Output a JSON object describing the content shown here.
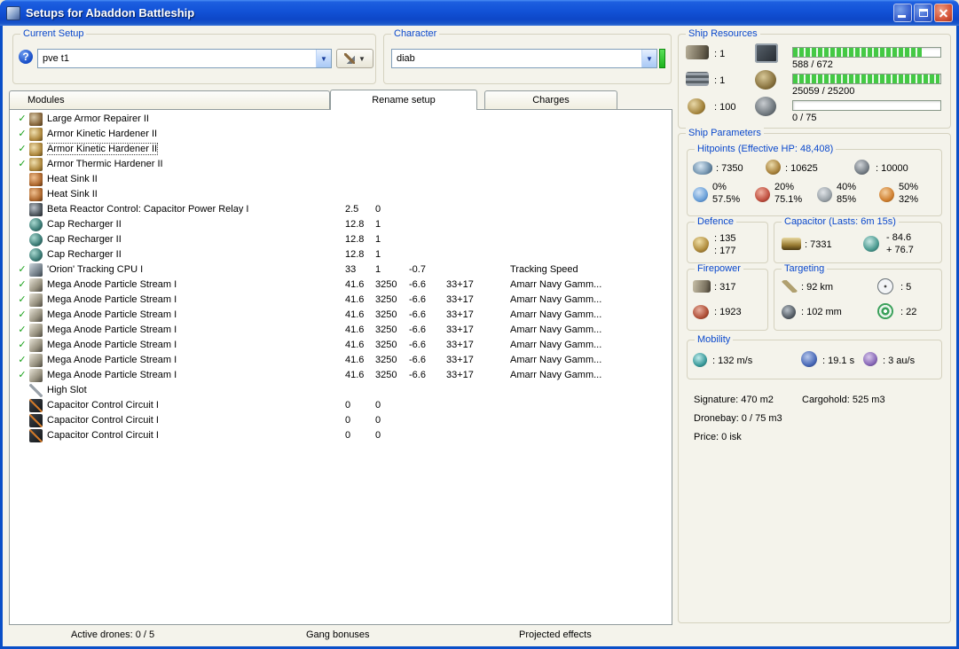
{
  "window": {
    "title": "Setups for Abaddon Battleship"
  },
  "setup": {
    "label": "Current Setup",
    "value": "pve t1"
  },
  "character": {
    "label": "Character",
    "value": "diab"
  },
  "tabs": [
    {
      "label": "Modules"
    },
    {
      "label": "Rename setup"
    },
    {
      "label": "Charges"
    }
  ],
  "modules": {
    "check_glyph": "✓",
    "rows": [
      {
        "checked": true,
        "icon": "armor-repairer",
        "name": "Large Armor Repairer II"
      },
      {
        "checked": true,
        "icon": "armor-hardener",
        "name": "Armor Kinetic Hardener II"
      },
      {
        "checked": true,
        "icon": "armor-hardener",
        "name": "Armor Kinetic Hardener II",
        "selected": true
      },
      {
        "checked": true,
        "icon": "armor-hardener",
        "name": "Armor Thermic Hardener II"
      },
      {
        "checked": false,
        "icon": "heat-sink",
        "name": "Heat Sink II"
      },
      {
        "checked": false,
        "icon": "heat-sink",
        "name": "Heat Sink II"
      },
      {
        "checked": false,
        "icon": "reactor-control",
        "name": "Beta Reactor Control: Capacitor Power Relay I",
        "c1": "2.5",
        "c2": "0"
      },
      {
        "checked": false,
        "icon": "cap-recharger",
        "name": "Cap Recharger II",
        "c1": "12.8",
        "c2": "1"
      },
      {
        "checked": false,
        "icon": "cap-recharger",
        "name": "Cap Recharger II",
        "c1": "12.8",
        "c2": "1"
      },
      {
        "checked": false,
        "icon": "cap-recharger",
        "name": "Cap Recharger II",
        "c1": "12.8",
        "c2": "1"
      },
      {
        "checked": true,
        "icon": "tracking-cpu",
        "name": "'Orion' Tracking CPU I",
        "c1": "33",
        "c2": "1",
        "c3": "-0.7",
        "c5": "Tracking Speed"
      },
      {
        "checked": true,
        "icon": "laser-turret",
        "name": "Mega Anode Particle Stream I",
        "c1": "41.6",
        "c2": "3250",
        "c3": "-6.6",
        "c4": "33+17",
        "c5": "Amarr Navy Gamm..."
      },
      {
        "checked": true,
        "icon": "laser-turret",
        "name": "Mega Anode Particle Stream I",
        "c1": "41.6",
        "c2": "3250",
        "c3": "-6.6",
        "c4": "33+17",
        "c5": "Amarr Navy Gamm..."
      },
      {
        "checked": true,
        "icon": "laser-turret",
        "name": "Mega Anode Particle Stream I",
        "c1": "41.6",
        "c2": "3250",
        "c3": "-6.6",
        "c4": "33+17",
        "c5": "Amarr Navy Gamm..."
      },
      {
        "checked": true,
        "icon": "laser-turret",
        "name": "Mega Anode Particle Stream I",
        "c1": "41.6",
        "c2": "3250",
        "c3": "-6.6",
        "c4": "33+17",
        "c5": "Amarr Navy Gamm..."
      },
      {
        "checked": true,
        "icon": "laser-turret",
        "name": "Mega Anode Particle Stream I",
        "c1": "41.6",
        "c2": "3250",
        "c3": "-6.6",
        "c4": "33+17",
        "c5": "Amarr Navy Gamm..."
      },
      {
        "checked": true,
        "icon": "laser-turret",
        "name": "Mega Anode Particle Stream I",
        "c1": "41.6",
        "c2": "3250",
        "c3": "-6.6",
        "c4": "33+17",
        "c5": "Amarr Navy Gamm..."
      },
      {
        "checked": true,
        "icon": "laser-turret",
        "name": "Mega Anode Particle Stream I",
        "c1": "41.6",
        "c2": "3250",
        "c3": "-6.6",
        "c4": "33+17",
        "c5": "Amarr Navy Gamm..."
      },
      {
        "checked": false,
        "icon": "wrench",
        "name": "High Slot"
      },
      {
        "checked": false,
        "icon": "cap-circuit",
        "name": "Capacitor Control Circuit I",
        "c1": "0",
        "c2": "0"
      },
      {
        "checked": false,
        "icon": "cap-circuit",
        "name": "Capacitor Control Circuit I",
        "c1": "0",
        "c2": "0"
      },
      {
        "checked": false,
        "icon": "cap-circuit",
        "name": "Capacitor Control Circuit I",
        "c1": "0",
        "c2": "0"
      }
    ]
  },
  "resources": {
    "label": "Ship Resources",
    "turrets": ": 1",
    "launchers": ": 1",
    "calibration": ": 100",
    "cpu": {
      "text": "588 / 672",
      "pct": 87.5
    },
    "powergrid": {
      "text": "25059 / 25200",
      "pct": 99.4
    },
    "drones": {
      "text": "0 / 75",
      "pct": 0
    }
  },
  "params": {
    "label": "Ship Parameters",
    "hitpoints": {
      "label": "Hitpoints (Effective HP: 48,408)",
      "shield": ": 7350",
      "armor": ": 10625",
      "structure": ": 10000",
      "resists": [
        {
          "top": "0%",
          "bottom": "57.5%"
        },
        {
          "top": "20%",
          "bottom": "75.1%"
        },
        {
          "top": "40%",
          "bottom": "85%"
        },
        {
          "top": "50%",
          "bottom": "32%"
        }
      ]
    },
    "defence": {
      "label": "Defence",
      "v1": ": 135",
      "v2": ": 177"
    },
    "capacitor": {
      "label": "Capacitor (Lasts: 6m 15s)",
      "amount": ": 7331",
      "drain": "- 84.6",
      "recharge": "+ 76.7"
    },
    "firepower": {
      "label": "Firepower",
      "volley": ": 317",
      "dps": ": 1923"
    },
    "targeting": {
      "label": "Targeting",
      "range": ": 92 km",
      "resolution": ": 102 mm",
      "max_targets": ": 5",
      "sensor": ": 22"
    },
    "mobility": {
      "label": "Mobility",
      "speed": ": 132 m/s",
      "align": ": 19.1 s",
      "warp": ": 3 au/s"
    },
    "signature": "Signature: 470 m2",
    "cargohold": "Cargohold: 525 m3",
    "dronebay": "Dronebay: 0 / 75 m3",
    "price": "Price: 0 isk"
  },
  "footer": {
    "active_drones": "Active drones: 0 / 5",
    "gang_bonuses": "Gang bonuses",
    "projected_effects": "Projected effects"
  }
}
